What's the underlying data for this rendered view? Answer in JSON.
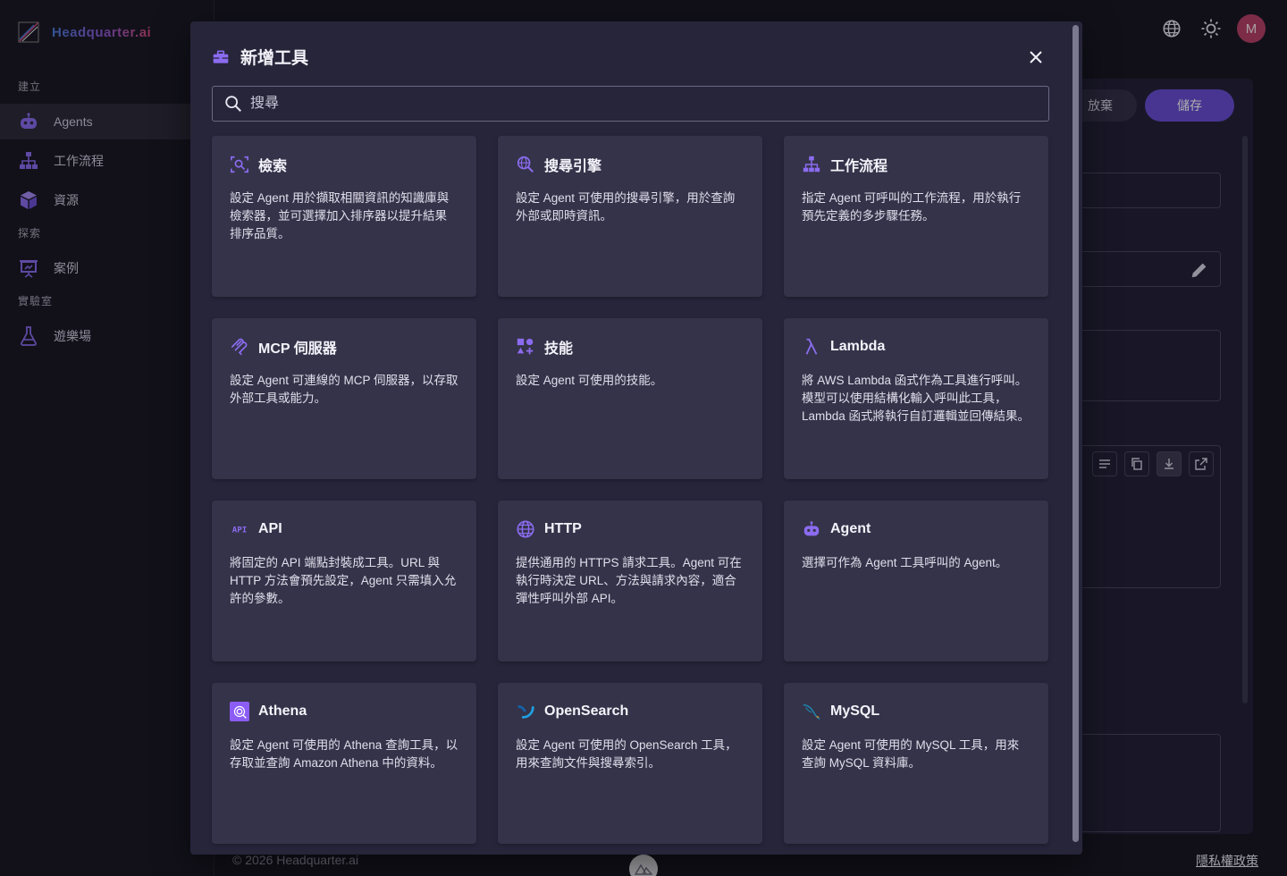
{
  "app": {
    "brand": "Headquarter.ai"
  },
  "sidebar": {
    "sections": [
      "建立",
      "探索",
      "實驗室"
    ],
    "items": [
      {
        "label": "Agents",
        "icon": "robot-icon",
        "active": true
      },
      {
        "label": "工作流程",
        "icon": "workflow-icon"
      },
      {
        "label": "資源",
        "icon": "box-icon"
      },
      {
        "label": "案例",
        "icon": "presentation-icon"
      },
      {
        "label": "遊樂場",
        "icon": "flask-icon"
      }
    ]
  },
  "header": {
    "avatar_initial": "M"
  },
  "background": {
    "discard_label": "放棄",
    "save_label": "儲存"
  },
  "footer": {
    "copyright": "© 2026 Headquarter.ai",
    "privacy": "隱私權政策"
  },
  "modal": {
    "title": "新增工具",
    "search_placeholder": "搜尋",
    "cards": [
      {
        "title": "檢索",
        "icon": "retrieval-icon",
        "desc": "設定 Agent 用於擷取相關資訊的知識庫與檢索器，並可選擇加入排序器以提升結果排序品質。"
      },
      {
        "title": "搜尋引擎",
        "icon": "search-engine-icon",
        "desc": "設定 Agent 可使用的搜尋引擎，用於查詢外部或即時資訊。"
      },
      {
        "title": "工作流程",
        "icon": "workflow-icon",
        "desc": "指定 Agent 可呼叫的工作流程，用於執行預先定義的多步驟任務。"
      },
      {
        "title": "MCP 伺服器",
        "icon": "mcp-icon",
        "desc": "設定 Agent 可連線的 MCP 伺服器，以存取外部工具或能力。"
      },
      {
        "title": "技能",
        "icon": "skills-icon",
        "desc": "設定 Agent 可使用的技能。"
      },
      {
        "title": "Lambda",
        "icon": "lambda-icon",
        "desc": "將 AWS Lambda 函式作為工具進行呼叫。模型可以使用結構化輸入呼叫此工具，Lambda 函式將執行自訂邏輯並回傳結果。"
      },
      {
        "title": "API",
        "icon": "api-icon",
        "desc": "將固定的 API 端點封裝成工具。URL 與 HTTP 方法會預先設定，Agent 只需填入允許的參數。"
      },
      {
        "title": "HTTP",
        "icon": "globe-icon",
        "desc": "提供通用的 HTTPS 請求工具。Agent 可在執行時決定 URL、方法與請求內容，適合彈性呼叫外部 API。"
      },
      {
        "title": "Agent",
        "icon": "robot-icon",
        "desc": "選擇可作為 Agent 工具呼叫的 Agent。"
      },
      {
        "title": "Athena",
        "icon": "athena-icon",
        "desc": "設定 Agent 可使用的 Athena 查詢工具，以存取並查詢 Amazon Athena 中的資料。"
      },
      {
        "title": "OpenSearch",
        "icon": "opensearch-icon",
        "desc": "設定 Agent 可使用的 OpenSearch 工具，用來查詢文件與搜尋索引。"
      },
      {
        "title": "MySQL",
        "icon": "mysql-icon",
        "desc": "設定 Agent 可使用的 MySQL 工具，用來查詢 MySQL 資料庫。"
      }
    ]
  },
  "colors": {
    "accent": "#6a4ed6",
    "icon_purple": "#8b6cf0",
    "card_bg": "#353349"
  }
}
